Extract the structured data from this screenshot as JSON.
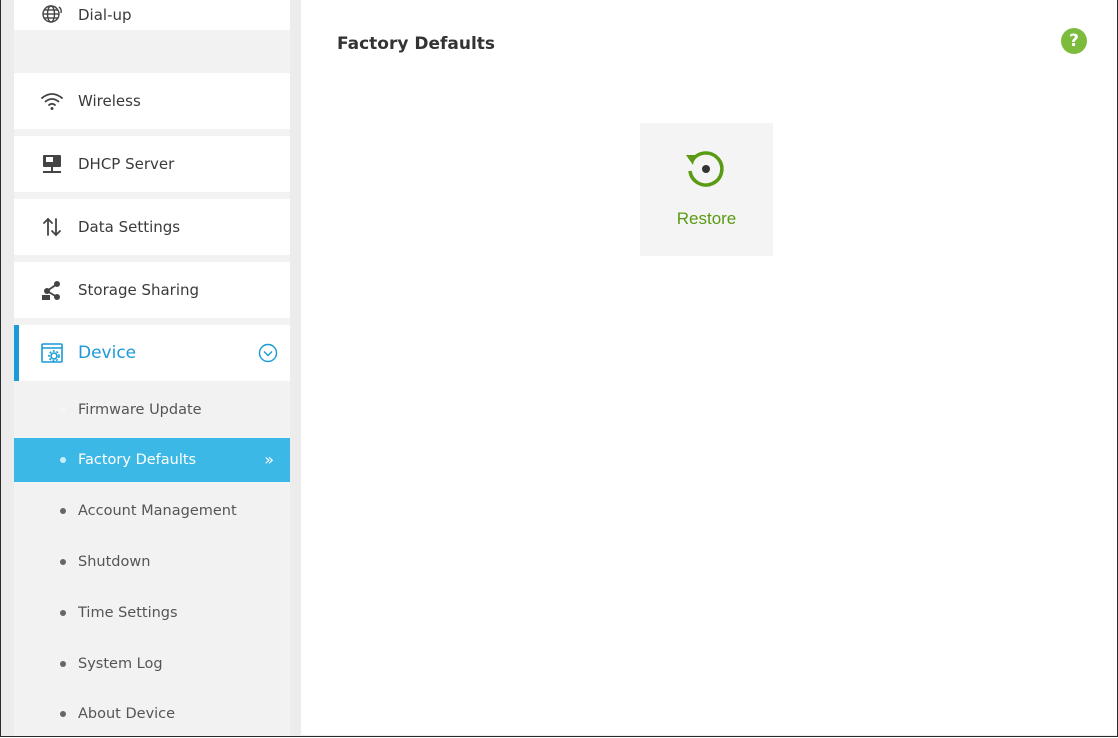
{
  "sidebar": {
    "items": [
      {
        "label": "Dial-up",
        "icon": "globe-icon"
      },
      {
        "label": "Wireless",
        "icon": "wifi-icon"
      },
      {
        "label": "DHCP Server",
        "icon": "dhcp-server-icon"
      },
      {
        "label": "Data Settings",
        "icon": "data-arrows-icon"
      },
      {
        "label": "Storage Sharing",
        "icon": "share-icon"
      },
      {
        "label": "Device",
        "icon": "device-settings-icon",
        "expanded": true
      }
    ],
    "subitems": [
      {
        "label": "Firmware Update"
      },
      {
        "label": "Factory Defaults",
        "selected": true
      },
      {
        "label": "Account Management"
      },
      {
        "label": "Shutdown"
      },
      {
        "label": "Time Settings"
      },
      {
        "label": "System Log"
      },
      {
        "label": "About Device"
      }
    ]
  },
  "main": {
    "title": "Factory Defaults",
    "help_icon": "?",
    "restore_label": "Restore"
  },
  "colors": {
    "accent": "#1a9ad6",
    "selected_bg": "#3cb8e6",
    "green": "#7dbb3c",
    "restore_text": "#5a9a14"
  }
}
